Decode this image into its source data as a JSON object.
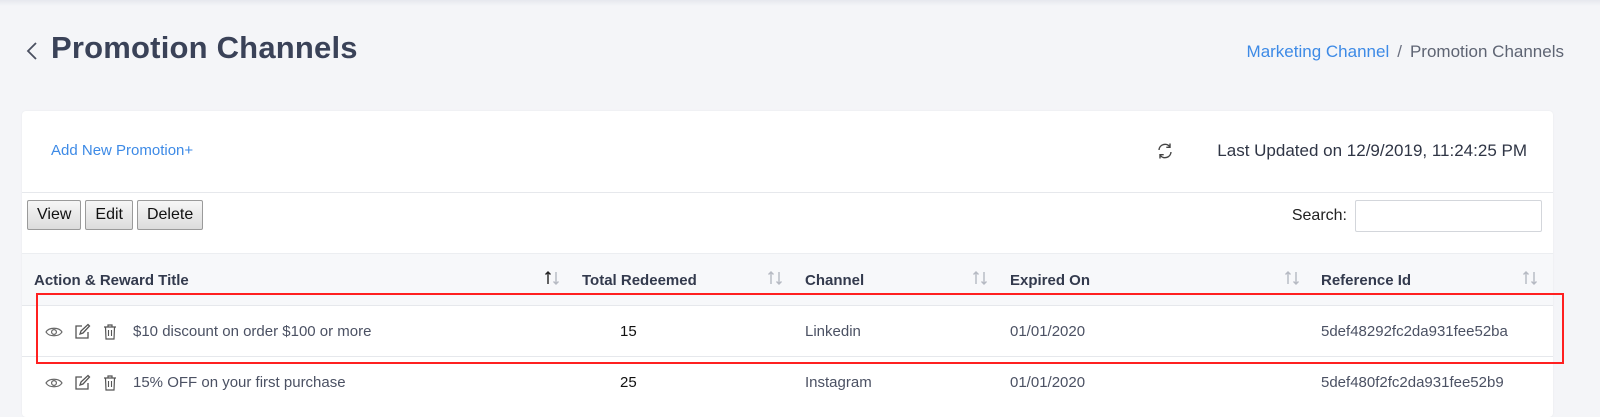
{
  "header": {
    "title": "Promotion Channels",
    "breadcrumb": [
      "Marketing Channel",
      "Promotion Channels"
    ],
    "breadcrumb_sep": "/"
  },
  "toolbar": {
    "add_label": "Add New Promotion+",
    "last_updated": "Last Updated on 12/9/2019, 11:24:25 PM",
    "buttons": [
      "View",
      "Edit",
      "Delete"
    ],
    "search_label": "Search:",
    "search_value": ""
  },
  "table": {
    "columns": [
      "Action & Reward Title",
      "Total Redeemed",
      "Channel",
      "Expired On",
      "Reference Id"
    ],
    "rows": [
      {
        "title": "$10 discount on order $100 or more",
        "redeemed": "15",
        "channel": "Linkedin",
        "expired": "01/01/2020",
        "ref": "5def48292fc2da931fee52ba"
      },
      {
        "title": "15% OFF on your first purchase",
        "redeemed": "25",
        "channel": "Instagram",
        "expired": "01/01/2020",
        "ref": "5def480f2fc2da931fee52b9"
      }
    ]
  },
  "icons": {
    "back": "chevron-left-icon",
    "refresh": "refresh-icon",
    "row_actions": [
      "eye-icon",
      "edit-icon",
      "trash-icon"
    ],
    "sort": "sort-icon"
  },
  "colors": {
    "link": "#3d8ae6",
    "highlight": "#ff2020",
    "background": "#f4f5f8"
  }
}
